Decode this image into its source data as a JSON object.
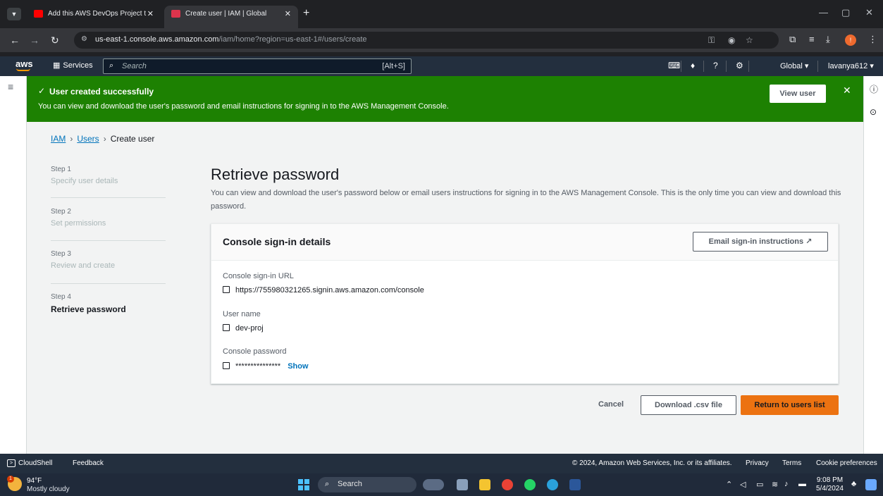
{
  "browser": {
    "tabs": [
      {
        "title": "Add this AWS DevOps Project t",
        "favicon_color": "#ff0000"
      },
      {
        "title": "Create user | IAM | Global",
        "favicon_color": "#dd344c"
      }
    ],
    "url_host": "us-east-1.console.aws.amazon.com",
    "url_path": "/iam/home?region=us-east-1#/users/create"
  },
  "aws_nav": {
    "logo": "aws",
    "services_label": "Services",
    "search_placeholder": "Search",
    "search_shortcut": "[Alt+S]",
    "region": "Global ▾",
    "account": "lavanya612 ▾"
  },
  "banner": {
    "title": "User created successfully",
    "message": "You can view and download the user's password and email instructions for signing in to the AWS Management Console.",
    "view_user_label": "View user",
    "color": "#1d8102"
  },
  "breadcrumb": {
    "items": [
      "IAM",
      "Users",
      "Create user"
    ]
  },
  "steps": [
    {
      "num": "Step 1",
      "label": "Specify user details"
    },
    {
      "num": "Step 2",
      "label": "Set permissions"
    },
    {
      "num": "Step 3",
      "label": "Review and create"
    },
    {
      "num": "Step 4",
      "label": "Retrieve password"
    }
  ],
  "main": {
    "title": "Retrieve password",
    "description": "You can view and download the user's password below or email users instructions for signing in to the AWS Management Console. This is the only time you can view and download this password."
  },
  "panel": {
    "title": "Console sign-in details",
    "email_button": "Email sign-in instructions",
    "fields": [
      {
        "label": "Console sign-in URL",
        "value": "https://755980321265.signin.aws.amazon.com/console"
      },
      {
        "label": "User name",
        "value": "dev-proj"
      },
      {
        "label": "Console password",
        "value": "***************",
        "action": "Show"
      }
    ]
  },
  "actions": {
    "cancel": "Cancel",
    "download": "Download .csv file",
    "return": "Return to users list",
    "primary_color": "#ec7211"
  },
  "footer": {
    "cloudshell": "CloudShell",
    "feedback": "Feedback",
    "copyright": "© 2024, Amazon Web Services, Inc. or its affiliates.",
    "privacy": "Privacy",
    "terms": "Terms",
    "cookies": "Cookie preferences"
  },
  "taskbar": {
    "temperature": "94°F",
    "condition": "Mostly cloudy",
    "search": "Search",
    "time": "9:08 PM",
    "date": "5/4/2024"
  }
}
